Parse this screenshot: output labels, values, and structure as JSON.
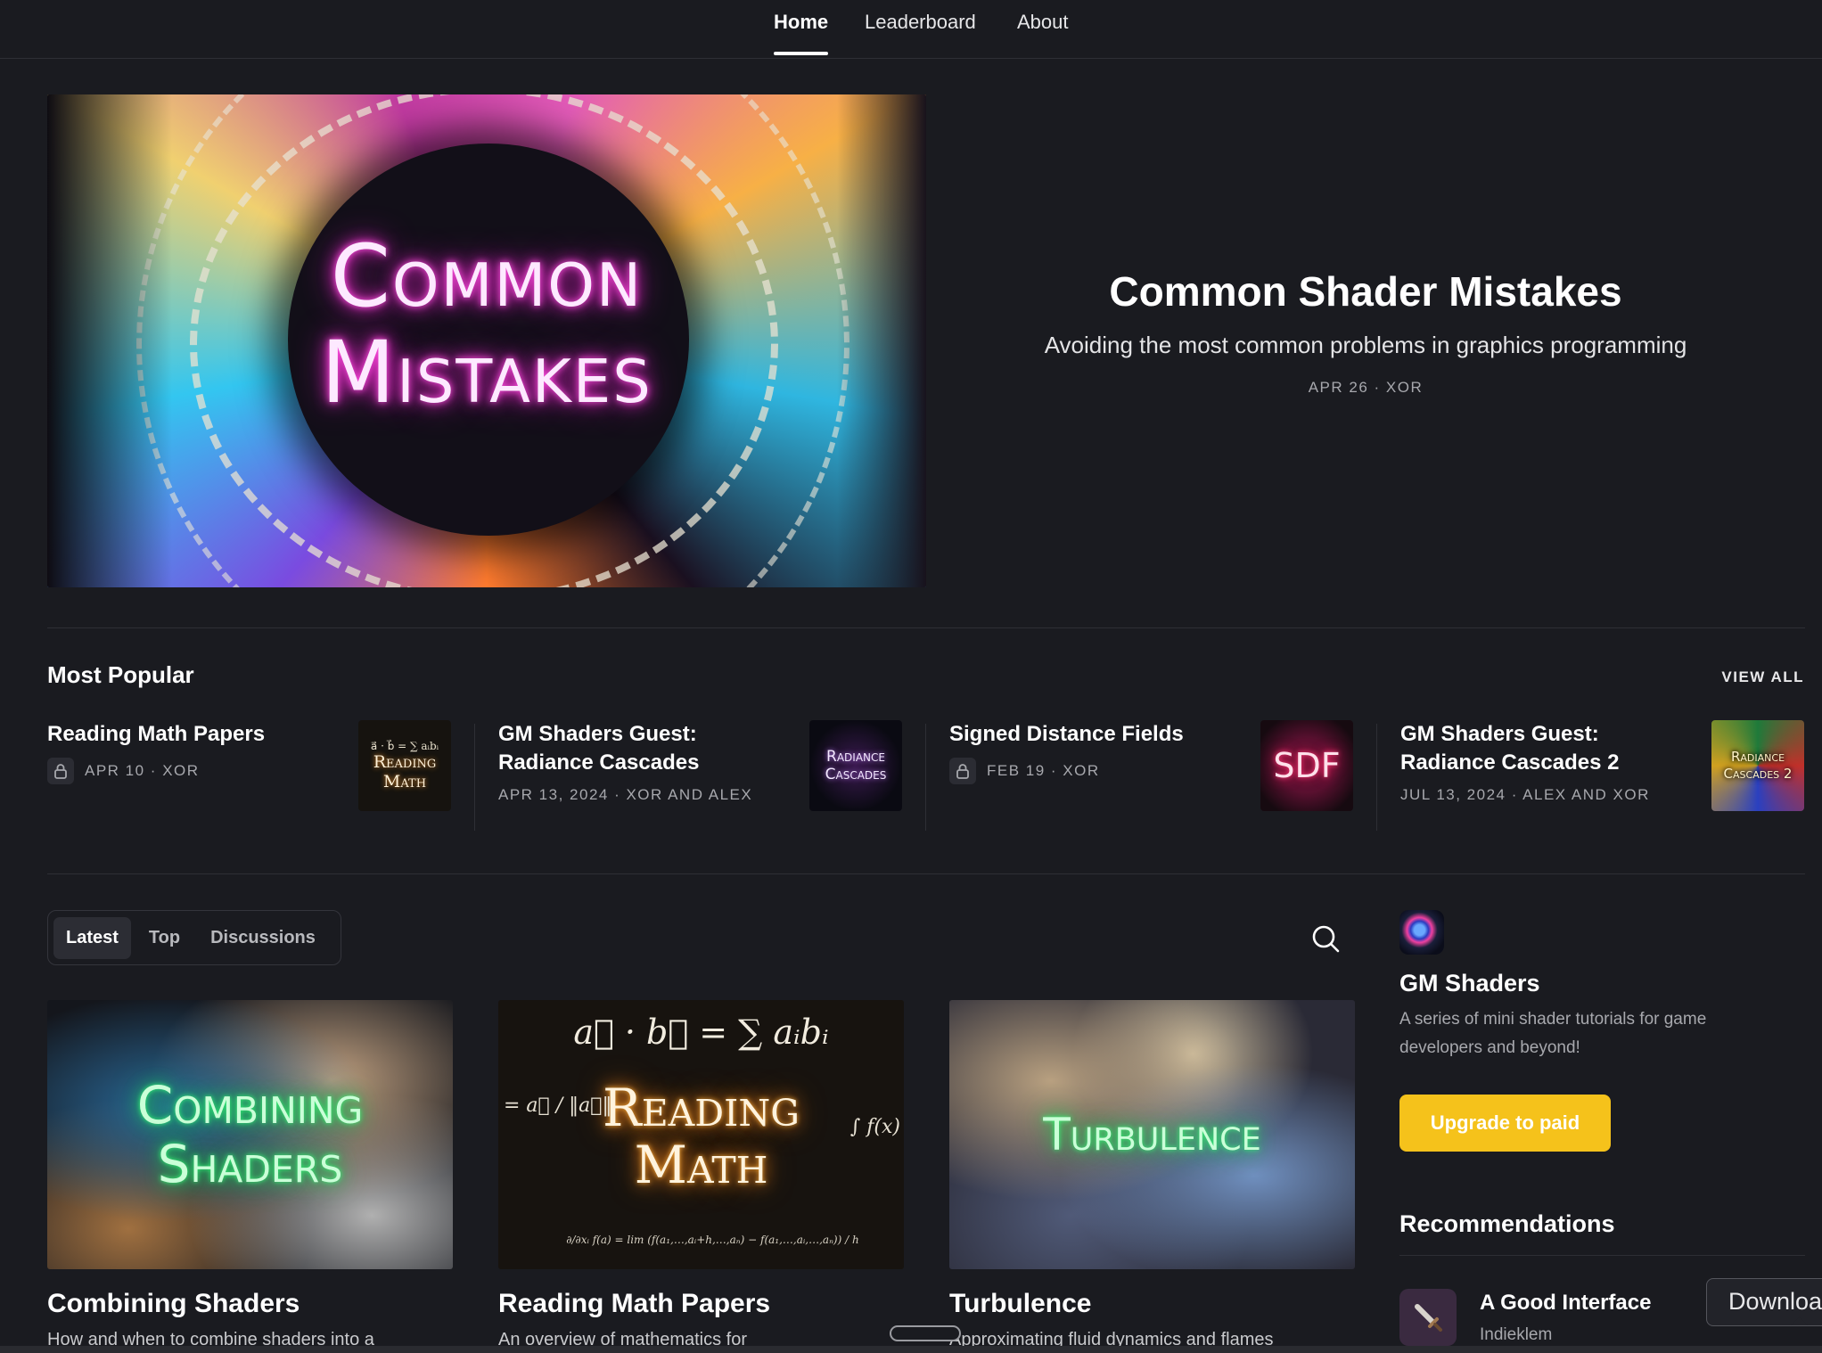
{
  "nav": {
    "tabs": [
      {
        "label": "Home",
        "active": true
      },
      {
        "label": "Leaderboard",
        "active": false
      },
      {
        "label": "About",
        "active": false
      }
    ]
  },
  "hero": {
    "image_text_line1": "Common",
    "image_text_line2": "Mistakes",
    "title": "Common Shader Mistakes",
    "subtitle": "Avoiding the most common problems in graphics programming",
    "meta": "APR 26 · XOR"
  },
  "popular": {
    "heading": "Most Popular",
    "view_all": "VIEW ALL",
    "items": [
      {
        "title": "Reading Math Papers",
        "meta": "APR 10 · XOR",
        "locked": true,
        "thumb_text": "Reading Math",
        "thumb_formula": "a⃗ · b⃗ = ∑ aᵢbᵢ"
      },
      {
        "title": "GM Shaders Guest: Radiance Cascades",
        "meta": "APR 13, 2024 · XOR AND ALEX",
        "locked": false,
        "thumb_text": "Radiance Cascades"
      },
      {
        "title": "Signed Distance Fields",
        "meta": "FEB 19 · XOR",
        "locked": true,
        "thumb_text": "SDF"
      },
      {
        "title": "GM Shaders Guest: Radiance Cascades 2",
        "meta": "JUL 13, 2024 · ALEX AND XOR",
        "locked": false,
        "thumb_text": "Radiance Cascades 2"
      }
    ]
  },
  "feed": {
    "tabs": [
      {
        "label": "Latest",
        "active": true
      },
      {
        "label": "Top",
        "active": false
      },
      {
        "label": "Discussions",
        "active": false
      }
    ],
    "posts": [
      {
        "image_text_1": "Combining",
        "image_text_2": "Shaders",
        "title": "Combining Shaders",
        "desc": "How and when to combine shaders into a"
      },
      {
        "image_text_1": "Reading",
        "image_text_2": "Math",
        "formula_top": "a⃗ · b⃗ = ∑ aᵢbᵢ",
        "formula_side": "∫ f(x)",
        "formula_left": "= a⃗ / ‖a⃗‖",
        "formula_bottom": "∂/∂xᵢ f(a) = lim (f(a₁,…,aᵢ+h,…,aₙ) − f(a₁,…,aᵢ,…,aₙ)) / h",
        "title": "Reading Math Papers",
        "desc": "An overview of mathematics for"
      },
      {
        "image_text_1": "Turbulence",
        "image_text_2": "",
        "title": "Turbulence",
        "desc": "Approximating fluid dynamics and flames"
      }
    ]
  },
  "sidebar": {
    "publication_name": "GM Shaders",
    "description": "A series of mini shader tutorials for game developers and beyond!",
    "upgrade_label": "Upgrade to paid",
    "recommendations_heading": "Recommendations",
    "recommendations": [
      {
        "name": "A Good Interface",
        "author": "Indieklem"
      }
    ]
  },
  "download_button": "Download",
  "colors": {
    "background": "#1a1b20",
    "accent": "#f5c21b",
    "muted_text": "#a7a8ad"
  }
}
